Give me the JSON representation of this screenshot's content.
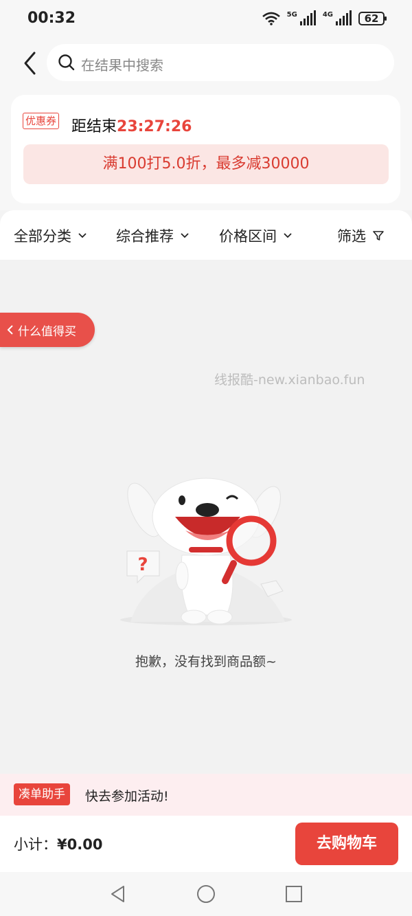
{
  "status": {
    "time": "00:32",
    "net1": "5G",
    "net2": "4G",
    "battery": "62"
  },
  "search": {
    "placeholder": "在结果中搜索"
  },
  "coupon": {
    "tag": "优惠券",
    "countdown_label": "距结束",
    "countdown_time": "23:27:26",
    "deal": "满100打5.0折，最多减30000"
  },
  "filters": [
    {
      "label": "全部分类"
    },
    {
      "label": "综合推荐"
    },
    {
      "label": "价格区间"
    },
    {
      "label": "筛选"
    }
  ],
  "side_tab": {
    "label": "什么值得买"
  },
  "watermark": "线报酷-new.xianbao.fun",
  "empty": {
    "message": "抱歉，没有找到商品额~"
  },
  "helper": {
    "tag": "凑单助手",
    "text": "快去参加活动!"
  },
  "cart": {
    "subtotal_label": "小计：",
    "subtotal_value": "¥0.00",
    "button": "去购物车"
  },
  "colors": {
    "accent": "#e8453c",
    "deal_bg": "#fbe6e4"
  }
}
